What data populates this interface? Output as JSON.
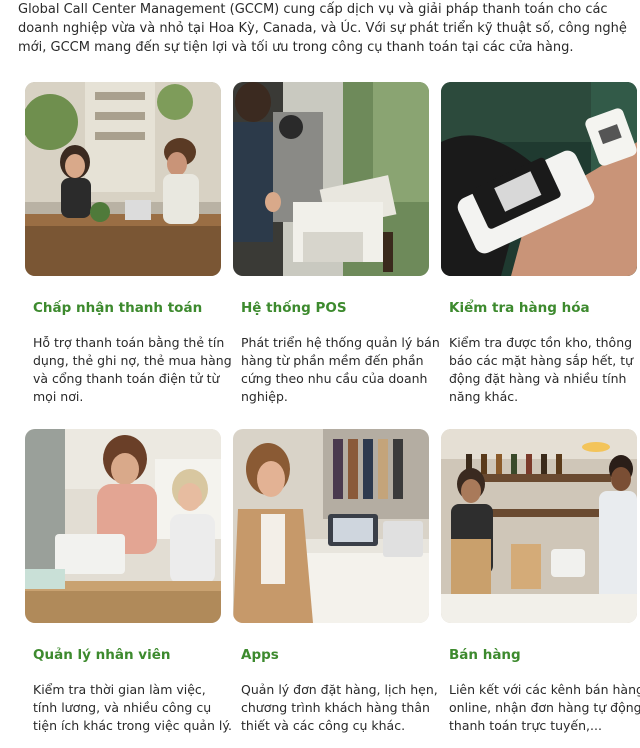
{
  "intro": {
    "text": "Global Call Center Management (GCCM) cung cấp dịch vụ và giải pháp thanh toán cho các doanh nghiệp vừa và nhỏ tại Hoa Kỳ, Canada, và Úc. Với sự phát triển kỹ thuật số, công nghệ mới, GCCM mang đến sự tiện lợi và tối ưu trong công cụ thanh toán tại các cửa hàng."
  },
  "services": [
    {
      "title": "Chấp nhận thanh toán",
      "description": "Hỗ trợ thanh toán bằng thẻ tín dụng, thẻ ghi nợ, thẻ mua hàng và cổng thanh toán điện tử từ mọi nơi.",
      "photo": "cafe-counter-photo"
    },
    {
      "title": "Hệ thống POS",
      "description": "Phát triển hệ thống quản lý bán hàng từ phần mềm đến phần cứng theo nhu cầu của doanh nghiệp.",
      "photo": "barista-pos-photo"
    },
    {
      "title": "Kiểm tra hàng hóa",
      "description": "Kiểm tra được tồn kho, thông báo các mặt hàng sắp hết, tự động đặt hàng và nhiều tính năng khác.",
      "photo": "handheld-scanner-photo"
    },
    {
      "title": "Quản lý nhân viên",
      "description": "Kiểm tra thời gian làm việc, tính lương, và nhiều công cụ tiện ích khác trong việc quản lý.",
      "photo": "staff-counter-photo"
    },
    {
      "title": "Apps",
      "description": "Quản lý đơn đặt hàng, lịch hẹn, chương trình khách hàng thân thiết và các công cụ khác.",
      "photo": "boutique-laptop-photo"
    },
    {
      "title": "Bán hàng",
      "description": "Liên kết với các kênh bán hàng online, nhận đơn hàng tự động, thanh toán trực tuyến,...",
      "photo": "takeout-bag-photo"
    }
  ],
  "colors": {
    "accent": "#3d8a2e",
    "text": "#2a2a2a"
  }
}
